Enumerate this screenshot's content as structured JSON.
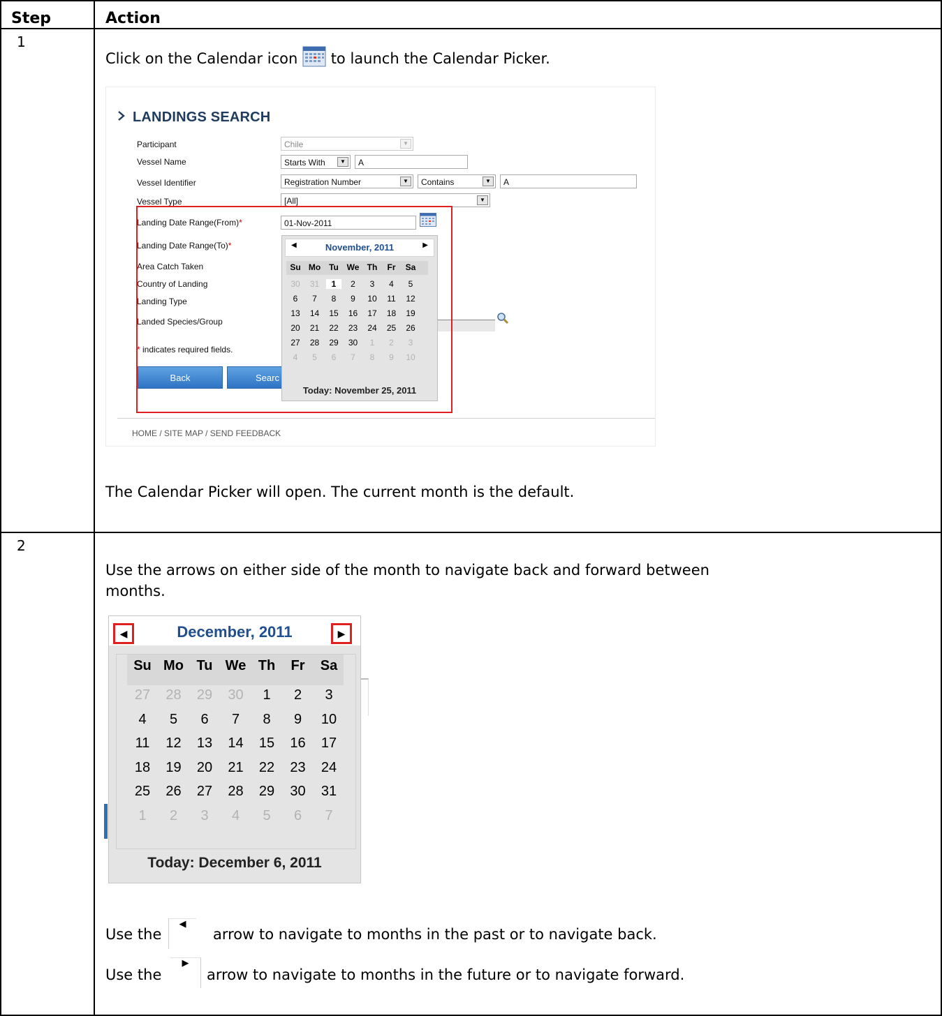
{
  "table": {
    "header_step": "Step",
    "header_action": "Action"
  },
  "rows": [
    {
      "step": "1",
      "line_before_icon": "Click on the Calendar icon",
      "line_after_icon": "to launch the Calendar Picker.",
      "result": "The Calendar Picker will open. The current month is the default."
    },
    {
      "step": "2",
      "intro_line1": "Use the arrows on either side of the month to navigate back and forward between",
      "intro_line2": "months.",
      "prev_before": "Use the",
      "prev_after": "arrow to navigate to months in the past or to navigate back.",
      "next_before": "Use the",
      "next_after": "arrow to navigate to months in the future or to navigate forward."
    }
  ],
  "landings_search": {
    "title": "LANDINGS SEARCH",
    "fields": [
      {
        "label": "Participant",
        "value": "Chile"
      },
      {
        "label": "Vessel Name",
        "operator": "Starts With",
        "value": "A"
      },
      {
        "label": "Vessel Identifier",
        "identifier_type": "Registration Number",
        "operator": "Contains",
        "value": "A"
      },
      {
        "label": "Vessel Type",
        "value": "[All]"
      },
      {
        "label": "Landing Date Range(From)",
        "required": "*",
        "value": "01-Nov-2011"
      },
      {
        "label": "Landing Date Range(To)",
        "required": "*"
      },
      {
        "label": "Area Catch Taken"
      },
      {
        "label": "Country of Landing"
      },
      {
        "label": "Landing Type"
      },
      {
        "label": "Landed Species/Group"
      }
    ],
    "required_note_mark": "*",
    "required_note": "indicates required fields.",
    "back_button": "Back",
    "search_button": "Searc",
    "footer": "HOME / SITE MAP / SEND FEEDBACK",
    "calendar": {
      "month": "November, 2011",
      "weekdays": [
        "Su",
        "Mo",
        "Tu",
        "We",
        "Th",
        "Fr",
        "Sa"
      ],
      "weeks": [
        [
          "30",
          "31",
          "1",
          "2",
          "3",
          "4",
          "5"
        ],
        [
          "6",
          "7",
          "8",
          "9",
          "10",
          "11",
          "12"
        ],
        [
          "13",
          "14",
          "15",
          "16",
          "17",
          "18",
          "19"
        ],
        [
          "20",
          "21",
          "22",
          "23",
          "24",
          "25",
          "26"
        ],
        [
          "27",
          "28",
          "29",
          "30",
          "1",
          "2",
          "3"
        ],
        [
          "4",
          "5",
          "6",
          "7",
          "8",
          "9",
          "10"
        ]
      ],
      "selected_day": "1",
      "today": "Today: November 25, 2011"
    }
  },
  "december_calendar": {
    "month": "December, 2011",
    "weekdays": [
      "Su",
      "Mo",
      "Tu",
      "We",
      "Th",
      "Fr",
      "Sa"
    ],
    "weeks": [
      [
        "27",
        "28",
        "29",
        "30",
        "1",
        "2",
        "3"
      ],
      [
        "4",
        "5",
        "6",
        "7",
        "8",
        "9",
        "10"
      ],
      [
        "11",
        "12",
        "13",
        "14",
        "15",
        "16",
        "17"
      ],
      [
        "18",
        "19",
        "20",
        "21",
        "22",
        "23",
        "24"
      ],
      [
        "25",
        "26",
        "27",
        "28",
        "29",
        "30",
        "31"
      ],
      [
        "1",
        "2",
        "3",
        "4",
        "5",
        "6",
        "7"
      ]
    ],
    "today": "Today: December 6, 2011"
  },
  "icons": {
    "calendar": "calendar-icon",
    "search": "magnifier-icon",
    "prev": "left-triangle-arrow-icon",
    "next": "right-triangle-arrow-icon"
  },
  "colors": {
    "highlight_frame": "#e02020",
    "title_blue": "#1f3b5e",
    "month_blue": "#1f4f8f",
    "button_blue": "#2f74c4"
  }
}
